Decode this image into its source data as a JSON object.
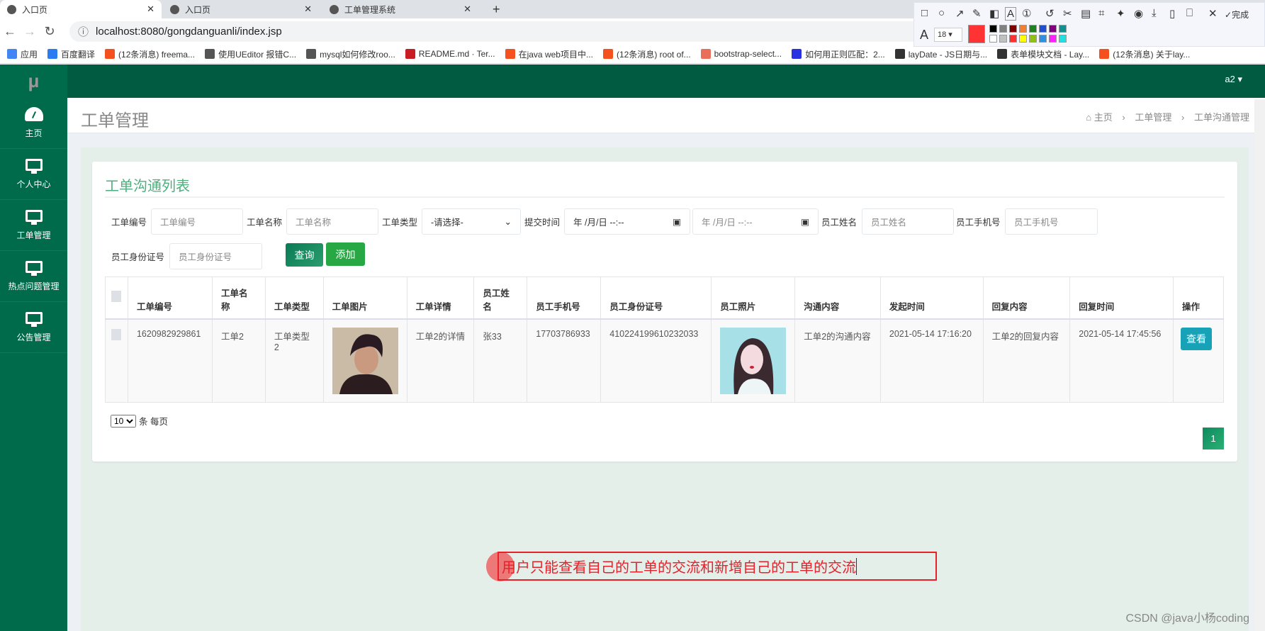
{
  "browser": {
    "tabs": [
      {
        "label": "入口页",
        "active": true
      },
      {
        "label": "入口页",
        "active": false
      },
      {
        "label": "工单管理系统",
        "active": false
      }
    ],
    "url": "localhost:8080/gongdanguanli/index.jsp",
    "bookmarks": [
      {
        "label": "应用",
        "icon": "apps-icon",
        "color": "#4285f4"
      },
      {
        "label": "百度翻译",
        "icon": "baidu-translate-icon",
        "color": "#2b7cf0"
      },
      {
        "label": "(12条消息) freema...",
        "icon": "csdn-icon",
        "color": "#f4511e"
      },
      {
        "label": "使用UEditor 报错C...",
        "icon": "bookmark-icon",
        "color": "#555555"
      },
      {
        "label": "mysql如何修改roo...",
        "icon": "bookmark-icon",
        "color": "#555555"
      },
      {
        "label": "README.md · Ter...",
        "icon": "gitee-icon",
        "color": "#c71d23"
      },
      {
        "label": "在java web项目中...",
        "icon": "csdn-icon",
        "color": "#f4511e"
      },
      {
        "label": "(12条消息) root of...",
        "icon": "csdn-icon",
        "color": "#f4511e"
      },
      {
        "label": "bootstrap-select...",
        "icon": "jianshu-icon",
        "color": "#ea6f5a"
      },
      {
        "label": "如何用正则匹配：2...",
        "icon": "baidu-icon",
        "color": "#2932e1"
      },
      {
        "label": "layDate - JS日期与...",
        "icon": "layui-icon",
        "color": "#333333"
      },
      {
        "label": "表单模块文档 - Lay...",
        "icon": "layui-icon",
        "color": "#333333"
      },
      {
        "label": "(12条消息) 关于lay...",
        "icon": "csdn-icon",
        "color": "#f4511e"
      }
    ]
  },
  "screenshot_tool": {
    "font_size": "18",
    "done_label": "完成",
    "current_color": "#ff3333",
    "palette": [
      "#000000",
      "#808080",
      "#800000",
      "#f08030",
      "#208020",
      "#2050d0",
      "#800080",
      "#109090",
      "#ffffff",
      "#c0c0c0",
      "#ff3030",
      "#ffff00",
      "#90c010",
      "#3090e0",
      "#ff20ff",
      "#20e0e0"
    ]
  },
  "app": {
    "logo": "μ",
    "user": "a2"
  },
  "sidebar": {
    "items": [
      {
        "label": "主页",
        "icon": "dashboard-icon"
      },
      {
        "label": "个人中心",
        "icon": "monitor-icon"
      },
      {
        "label": "工单管理",
        "icon": "monitor-icon"
      },
      {
        "label": "热点问题管理",
        "icon": "monitor-icon"
      },
      {
        "label": "公告管理",
        "icon": "monitor-icon"
      }
    ]
  },
  "page": {
    "title": "工单管理",
    "breadcrumb": [
      "主页",
      "工单管理",
      "工单沟通管理"
    ]
  },
  "card": {
    "title": "工单沟通列表"
  },
  "filters": {
    "order_no": {
      "label": "工单编号",
      "placeholder": "工单编号"
    },
    "order_name": {
      "label": "工单名称",
      "placeholder": "工单名称"
    },
    "order_type": {
      "label": "工单类型",
      "value": "-请选择-"
    },
    "submit_time": {
      "label": "提交时间",
      "from": "年 /月/日 --:--",
      "to": "年 /月/日 --:--"
    },
    "staff_name": {
      "label": "员工姓名",
      "placeholder": "员工姓名"
    },
    "staff_phone": {
      "label": "员工手机号",
      "placeholder": "员工手机号"
    },
    "staff_id": {
      "label": "员工身份证号",
      "placeholder": "员工身份证号"
    },
    "query_label": "查询",
    "add_label": "添加"
  },
  "table": {
    "headers": [
      "工单编号",
      "工单名称",
      "工单类型",
      "工单图片",
      "工单详情",
      "员工姓名",
      "员工手机号",
      "员工身份证号",
      "员工照片",
      "沟通内容",
      "发起时间",
      "回复内容",
      "回复时间",
      "操作"
    ],
    "rows": [
      {
        "order_no": "1620982929861",
        "order_name": "工单2",
        "order_type": "工单类型2",
        "detail": "工单2的详情",
        "staff_name": "张33",
        "phone": "17703786933",
        "id_card": "410224199610232033",
        "content": "工单2的沟通内容",
        "start_time": "2021-05-14 17:16:20",
        "reply": "工单2的回复内容",
        "reply_time": "2021-05-14 17:45:56",
        "action": "查看"
      }
    ]
  },
  "pagination": {
    "per_page": "10",
    "per_page_suffix": "条 每页",
    "pages": [
      "1"
    ]
  },
  "annotation": {
    "text": "用户只能查看自己的工单的交流和新增自己的工单的交流"
  },
  "watermark": "CSDN @java小杨coding"
}
